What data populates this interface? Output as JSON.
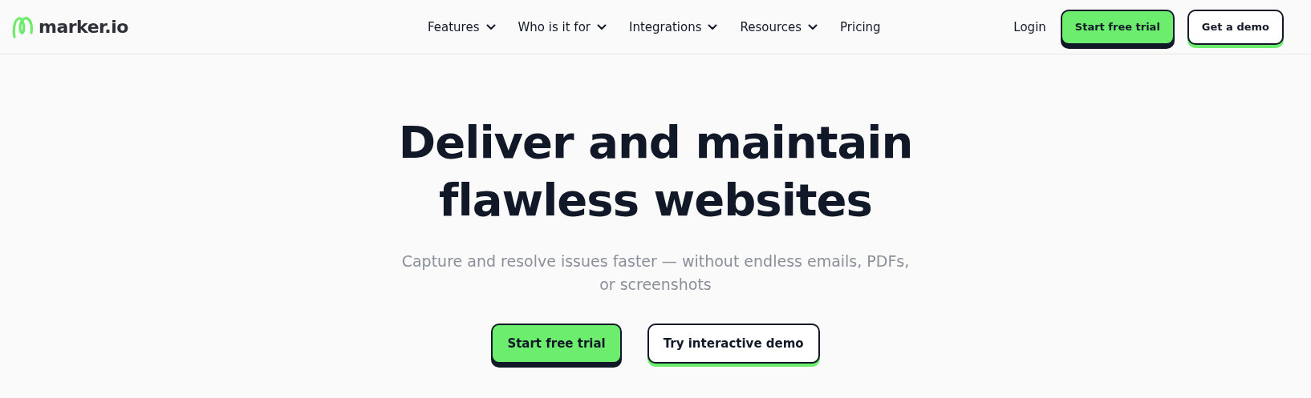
{
  "header": {
    "logo": {
      "text": "marker.io"
    },
    "nav": [
      {
        "label": "Features",
        "has_menu": true
      },
      {
        "label": "Who is it for",
        "has_menu": true
      },
      {
        "label": "Integrations",
        "has_menu": true
      },
      {
        "label": "Resources",
        "has_menu": true
      },
      {
        "label": "Pricing",
        "has_menu": false
      }
    ],
    "actions": [
      {
        "kind": "link",
        "label": "Login"
      },
      {
        "kind": "primary",
        "label": "Start free trial"
      },
      {
        "kind": "secondary",
        "label": "Get a demo"
      }
    ]
  },
  "hero": {
    "title_lines": [
      "Deliver and maintain",
      "flawless websites"
    ],
    "subtitle": "Capture and resolve issues faster — without endless emails, PDFs, or screenshots",
    "buttons": [
      {
        "kind": "primary",
        "label": "Start free trial"
      },
      {
        "kind": "secondary",
        "label": "Try interactive demo"
      }
    ]
  }
}
